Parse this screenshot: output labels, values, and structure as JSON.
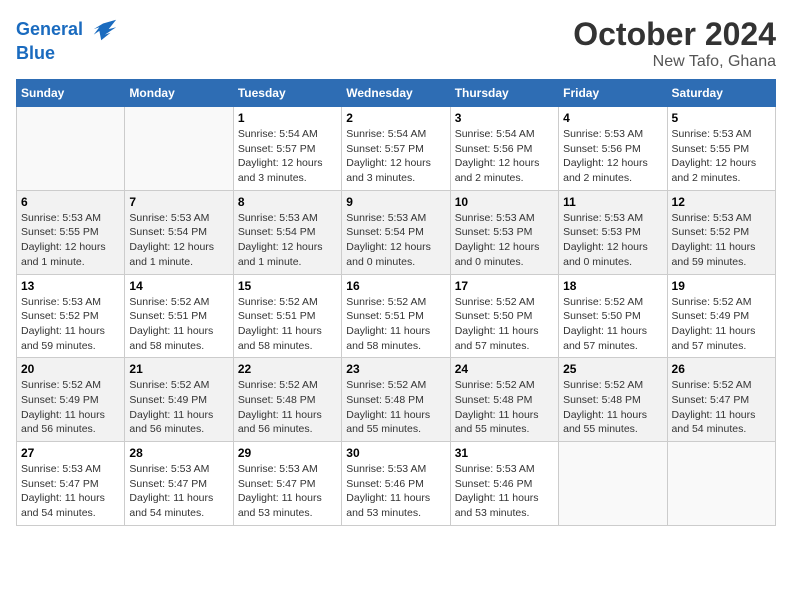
{
  "header": {
    "logo_line1": "General",
    "logo_line2": "Blue",
    "month": "October 2024",
    "location": "New Tafo, Ghana"
  },
  "weekdays": [
    "Sunday",
    "Monday",
    "Tuesday",
    "Wednesday",
    "Thursday",
    "Friday",
    "Saturday"
  ],
  "weeks": [
    [
      {
        "day": "",
        "info": ""
      },
      {
        "day": "",
        "info": ""
      },
      {
        "day": "1",
        "info": "Sunrise: 5:54 AM\nSunset: 5:57 PM\nDaylight: 12 hours\nand 3 minutes."
      },
      {
        "day": "2",
        "info": "Sunrise: 5:54 AM\nSunset: 5:57 PM\nDaylight: 12 hours\nand 3 minutes."
      },
      {
        "day": "3",
        "info": "Sunrise: 5:54 AM\nSunset: 5:56 PM\nDaylight: 12 hours\nand 2 minutes."
      },
      {
        "day": "4",
        "info": "Sunrise: 5:53 AM\nSunset: 5:56 PM\nDaylight: 12 hours\nand 2 minutes."
      },
      {
        "day": "5",
        "info": "Sunrise: 5:53 AM\nSunset: 5:55 PM\nDaylight: 12 hours\nand 2 minutes."
      }
    ],
    [
      {
        "day": "6",
        "info": "Sunrise: 5:53 AM\nSunset: 5:55 PM\nDaylight: 12 hours\nand 1 minute."
      },
      {
        "day": "7",
        "info": "Sunrise: 5:53 AM\nSunset: 5:54 PM\nDaylight: 12 hours\nand 1 minute."
      },
      {
        "day": "8",
        "info": "Sunrise: 5:53 AM\nSunset: 5:54 PM\nDaylight: 12 hours\nand 1 minute."
      },
      {
        "day": "9",
        "info": "Sunrise: 5:53 AM\nSunset: 5:54 PM\nDaylight: 12 hours\nand 0 minutes."
      },
      {
        "day": "10",
        "info": "Sunrise: 5:53 AM\nSunset: 5:53 PM\nDaylight: 12 hours\nand 0 minutes."
      },
      {
        "day": "11",
        "info": "Sunrise: 5:53 AM\nSunset: 5:53 PM\nDaylight: 12 hours\nand 0 minutes."
      },
      {
        "day": "12",
        "info": "Sunrise: 5:53 AM\nSunset: 5:52 PM\nDaylight: 11 hours\nand 59 minutes."
      }
    ],
    [
      {
        "day": "13",
        "info": "Sunrise: 5:53 AM\nSunset: 5:52 PM\nDaylight: 11 hours\nand 59 minutes."
      },
      {
        "day": "14",
        "info": "Sunrise: 5:52 AM\nSunset: 5:51 PM\nDaylight: 11 hours\nand 58 minutes."
      },
      {
        "day": "15",
        "info": "Sunrise: 5:52 AM\nSunset: 5:51 PM\nDaylight: 11 hours\nand 58 minutes."
      },
      {
        "day": "16",
        "info": "Sunrise: 5:52 AM\nSunset: 5:51 PM\nDaylight: 11 hours\nand 58 minutes."
      },
      {
        "day": "17",
        "info": "Sunrise: 5:52 AM\nSunset: 5:50 PM\nDaylight: 11 hours\nand 57 minutes."
      },
      {
        "day": "18",
        "info": "Sunrise: 5:52 AM\nSunset: 5:50 PM\nDaylight: 11 hours\nand 57 minutes."
      },
      {
        "day": "19",
        "info": "Sunrise: 5:52 AM\nSunset: 5:49 PM\nDaylight: 11 hours\nand 57 minutes."
      }
    ],
    [
      {
        "day": "20",
        "info": "Sunrise: 5:52 AM\nSunset: 5:49 PM\nDaylight: 11 hours\nand 56 minutes."
      },
      {
        "day": "21",
        "info": "Sunrise: 5:52 AM\nSunset: 5:49 PM\nDaylight: 11 hours\nand 56 minutes."
      },
      {
        "day": "22",
        "info": "Sunrise: 5:52 AM\nSunset: 5:48 PM\nDaylight: 11 hours\nand 56 minutes."
      },
      {
        "day": "23",
        "info": "Sunrise: 5:52 AM\nSunset: 5:48 PM\nDaylight: 11 hours\nand 55 minutes."
      },
      {
        "day": "24",
        "info": "Sunrise: 5:52 AM\nSunset: 5:48 PM\nDaylight: 11 hours\nand 55 minutes."
      },
      {
        "day": "25",
        "info": "Sunrise: 5:52 AM\nSunset: 5:48 PM\nDaylight: 11 hours\nand 55 minutes."
      },
      {
        "day": "26",
        "info": "Sunrise: 5:52 AM\nSunset: 5:47 PM\nDaylight: 11 hours\nand 54 minutes."
      }
    ],
    [
      {
        "day": "27",
        "info": "Sunrise: 5:53 AM\nSunset: 5:47 PM\nDaylight: 11 hours\nand 54 minutes."
      },
      {
        "day": "28",
        "info": "Sunrise: 5:53 AM\nSunset: 5:47 PM\nDaylight: 11 hours\nand 54 minutes."
      },
      {
        "day": "29",
        "info": "Sunrise: 5:53 AM\nSunset: 5:47 PM\nDaylight: 11 hours\nand 53 minutes."
      },
      {
        "day": "30",
        "info": "Sunrise: 5:53 AM\nSunset: 5:46 PM\nDaylight: 11 hours\nand 53 minutes."
      },
      {
        "day": "31",
        "info": "Sunrise: 5:53 AM\nSunset: 5:46 PM\nDaylight: 11 hours\nand 53 minutes."
      },
      {
        "day": "",
        "info": ""
      },
      {
        "day": "",
        "info": ""
      }
    ]
  ]
}
